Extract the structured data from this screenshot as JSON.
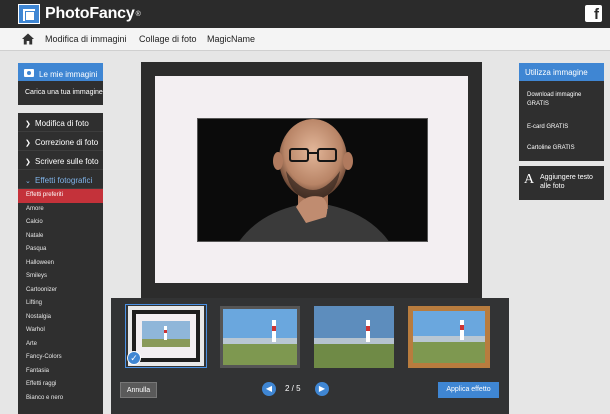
{
  "header": {
    "logo_text": "PhotoFancy",
    "logo_reg": "®",
    "facebook_glyph": "f"
  },
  "nav": {
    "items": [
      "Modifica di immagini",
      "Collage di foto",
      "MagicName"
    ]
  },
  "left": {
    "my_images": "Le mie immagini",
    "upload": "Carica una tua immagine",
    "menu": [
      "Modifica di foto",
      "Correzione di foto",
      "Scrivere sulle foto",
      "Effetti fotografici"
    ],
    "effects": [
      "Effetti preferiti",
      "Amore",
      "Calcio",
      "Natale",
      "Pasqua",
      "Halloween",
      "Smileys",
      "Cartoonizer",
      "Lifting",
      "Nostalgia",
      "Warhol",
      "Arte",
      "Fancy-Colors",
      "Fantasia",
      "Effetti raggi",
      "Bianco e nero"
    ],
    "selected_effect": "Effetti preferiti"
  },
  "right": {
    "use_image": "Utilizza immagine",
    "download": "Download immagine GRATIS",
    "ecard": "E-card GRATIS",
    "cartoline": "Cartoline GRATIS",
    "add_text_glyph": "A",
    "add_text": "Aggiungere testo alle foto"
  },
  "bottom": {
    "cancel": "Annulla",
    "page": "2 / 5",
    "apply": "Applica effetto",
    "selected_check": "✓"
  },
  "colors": {
    "accent": "#3f86d3",
    "selected": "#c4323a",
    "dark": "#2f2f2f"
  }
}
